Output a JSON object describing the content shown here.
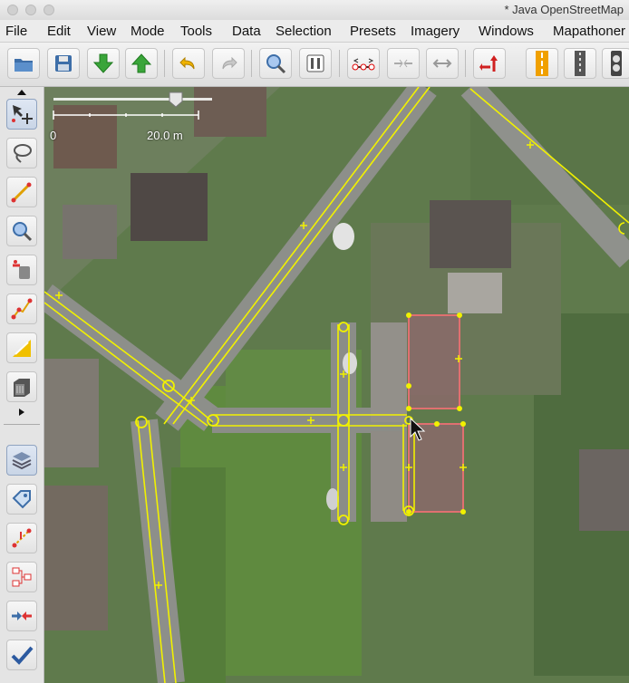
{
  "window": {
    "title": "* Java OpenStreetMap"
  },
  "menu": [
    "File",
    "Edit",
    "View",
    "Mode",
    "Tools",
    "Data",
    "Selection",
    "Presets",
    "Imagery",
    "Windows",
    "Mapathoner"
  ],
  "toolbar_icons": [
    "open-icon",
    "save-icon",
    "download-icon",
    "upload-icon",
    "undo-icon",
    "redo-icon",
    "zoom-icon",
    "preferences-icon",
    "split-way-icon",
    "combine-way-icon",
    "reverse-way-icon",
    "upload-changes-icon",
    "road-preset-icon",
    "railway-preset-icon",
    "traffic-signal-icon"
  ],
  "sidebar_icons": [
    "select-icon",
    "lasso-icon",
    "draw-icon",
    "zoom-icon",
    "delete-icon",
    "improve-way-icon",
    "parallel-way-icon",
    "building-icon",
    "layers-icon",
    "tags-icon",
    "validation-icon",
    "relations-icon",
    "conflicts-icon",
    "changeset-icon"
  ],
  "scale": {
    "zero": "0",
    "distance": "20.0 m"
  },
  "colors": {
    "way": "#f1f100",
    "building_outline": "#e07070",
    "building_fill": "#8a6a6a"
  }
}
